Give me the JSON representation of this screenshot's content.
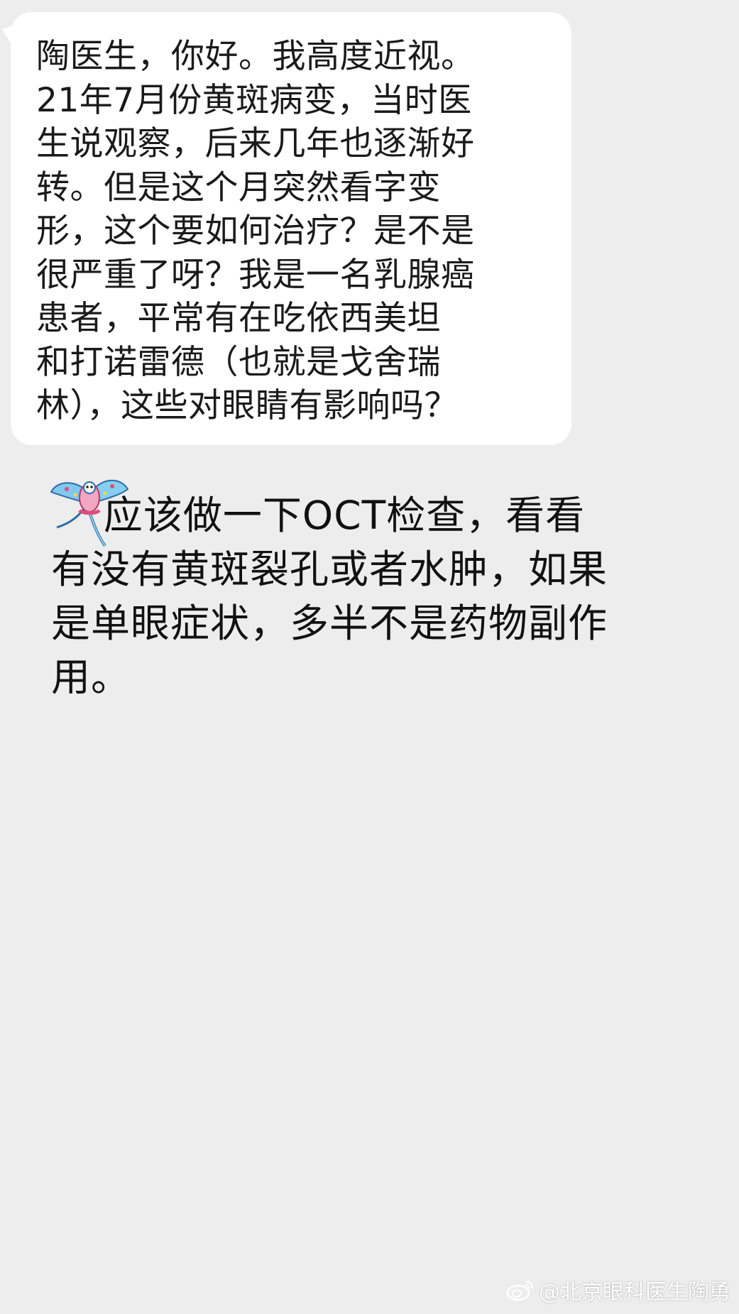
{
  "conversation": {
    "question_lines": [
      "陶医生，你好。我高度近视。",
      "21年7月份黄斑病变，当时医",
      "生说观察，后来几年也逐渐好",
      "转。但是这个月突然看字变",
      "形，这个要如何治疗？是不是",
      "很严重了呀？我是一名乳腺癌",
      "患者，平常有在吃依西美坦",
      "和打诺雷德（也就是戈舍瑞",
      "林），这些对眼睛有影响吗？"
    ],
    "reply_lines": [
      "    应该做一下OCT检查，看看",
      "有没有黄斑裂孔或者水肿，如果",
      "是单眼症状，多半不是药物副作",
      "用。"
    ]
  },
  "watermark": {
    "text": "@北京眼科医生陶勇",
    "icon": "weibo-icon"
  },
  "colors": {
    "background": "#ededed",
    "bubble": "#ffffff",
    "text": "#1a1a1a"
  }
}
